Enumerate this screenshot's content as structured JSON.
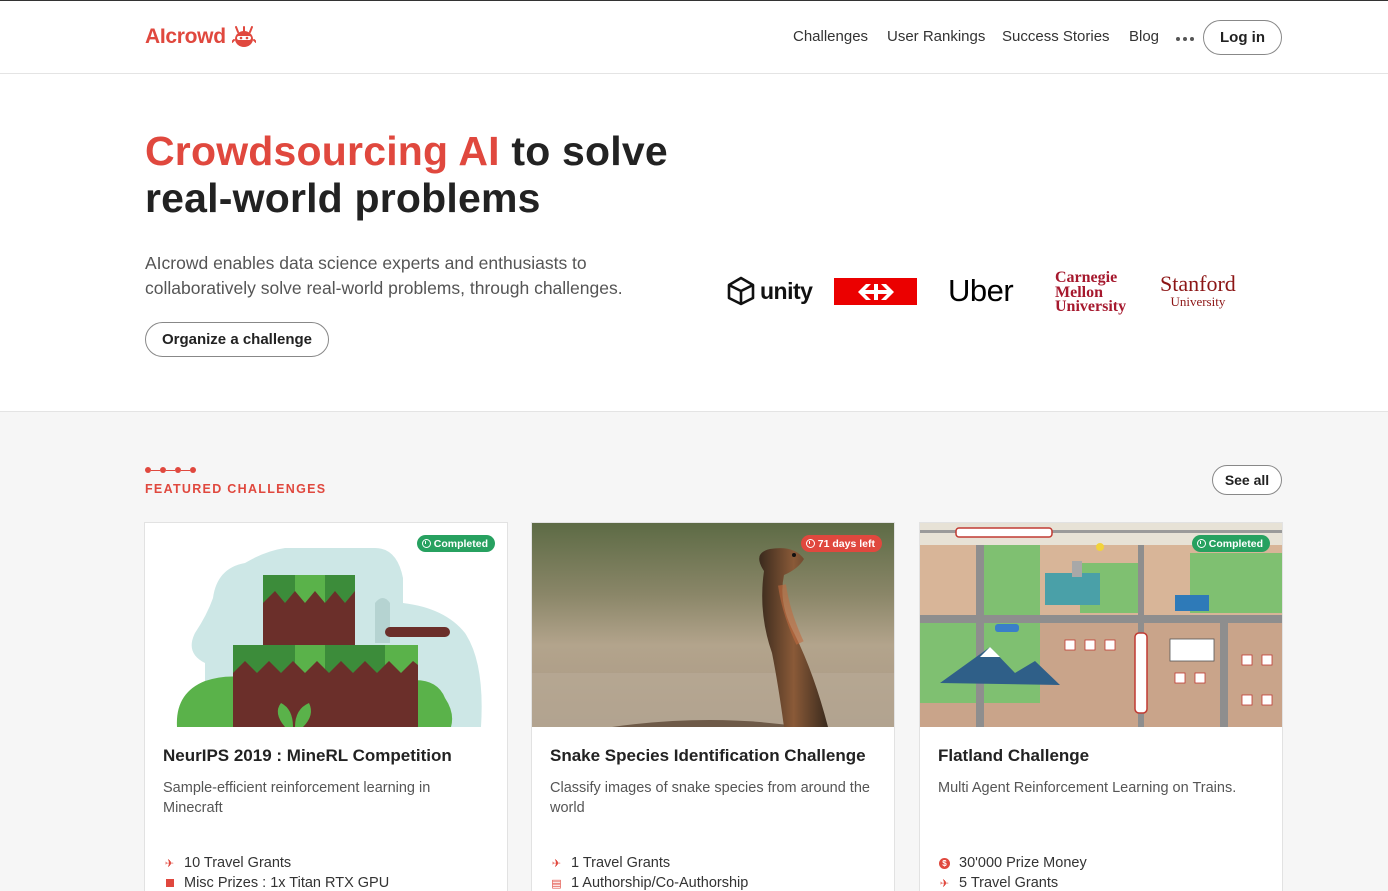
{
  "brand": {
    "ai": "AI",
    "crowd": "crowd"
  },
  "nav": {
    "items": [
      "Challenges",
      "User Rankings",
      "Success Stories",
      "Blog"
    ],
    "more_icon": "ellipsis-icon",
    "login_label": "Log in"
  },
  "hero": {
    "title_highlight": "Crowdsourcing AI",
    "title_rest_line1": " to solve",
    "title_line2": "real-world problems",
    "subtitle": "AIcrowd enables data science experts and enthusiasts to collaboratively solve real-world problems, through challenges.",
    "cta_label": "Organize a challenge"
  },
  "partners": {
    "unity": "unity",
    "uber": "Uber",
    "cmu": [
      "Carnegie",
      "Mellon",
      "University"
    ],
    "stanford": [
      "Stanford",
      "University"
    ]
  },
  "featured": {
    "label": "FEATURED CHALLENGES",
    "see_all": "See all",
    "cards": [
      {
        "title": "NeurIPS 2019 : MineRL Competition",
        "description": "Sample-efficient reinforcement learning in Minecraft",
        "badge": "Completed",
        "prizes": [
          {
            "icon": "plane-icon",
            "text": "10 Travel Grants"
          },
          {
            "icon": "square-icon",
            "text": "Misc Prizes : 1x Titan RTX GPU"
          }
        ]
      },
      {
        "title": "Snake Species Identification Challenge",
        "description": "Classify images of snake species from around the world",
        "badge": "71 days left",
        "prizes": [
          {
            "icon": "plane-icon",
            "text": "1 Travel Grants"
          },
          {
            "icon": "document-icon",
            "text": "1 Authorship/Co-Authorship"
          }
        ]
      },
      {
        "title": "Flatland Challenge",
        "description": "Multi Agent Reinforcement Learning on Trains.",
        "badge": "Completed",
        "prizes": [
          {
            "icon": "dollar-icon",
            "text": "30'000 Prize Money"
          },
          {
            "icon": "plane-icon",
            "text": "5 Travel Grants"
          }
        ]
      }
    ]
  },
  "colors": {
    "accent": "#e0483e",
    "completed": "#27a160"
  }
}
